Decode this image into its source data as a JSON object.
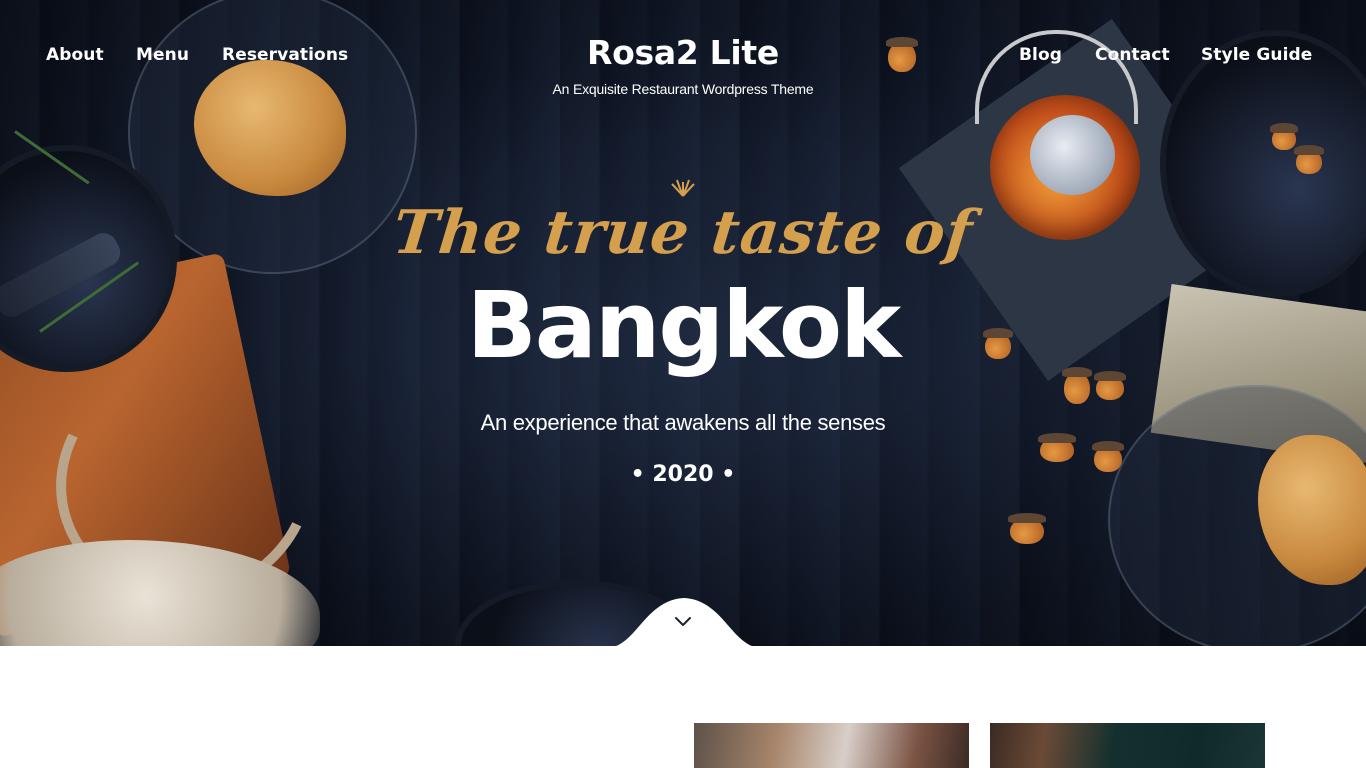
{
  "nav": {
    "left": [
      {
        "label": "About"
      },
      {
        "label": "Menu"
      },
      {
        "label": "Reservations"
      }
    ],
    "right": [
      {
        "label": "Blog"
      },
      {
        "label": "Contact"
      },
      {
        "label": "Style Guide"
      }
    ]
  },
  "brand": {
    "title": "Rosa2 Lite",
    "tagline": "An Exquisite Restaurant Wordpress Theme"
  },
  "hero": {
    "script_line": "The true taste of",
    "headline": "Bangkok",
    "subline": "An experience that awakens all the senses",
    "year": "• 2020 •",
    "ornament_icon": "lotus-ornament-icon",
    "scroll_icon": "chevron-down-icon"
  },
  "colors": {
    "accent_gold": "#d4a04e",
    "hero_background": "#121a29",
    "text": "#ffffff",
    "page_background": "#ffffff"
  }
}
